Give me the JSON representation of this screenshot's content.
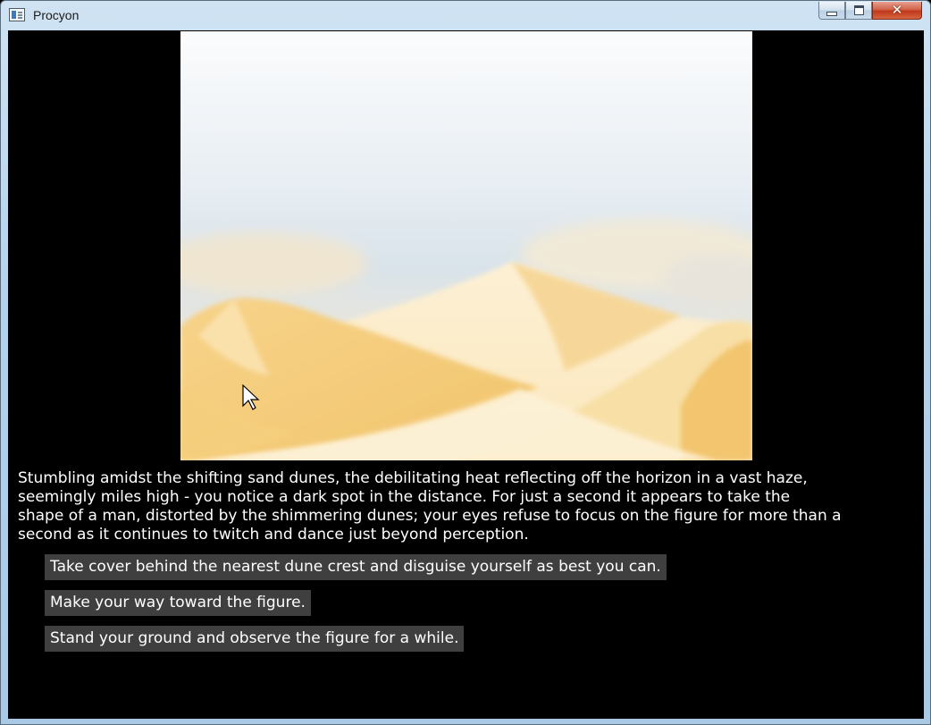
{
  "window": {
    "title": "Procyon",
    "icons": {
      "app": "window-app-icon",
      "minimize": "minimize-icon",
      "maximize": "maximize-icon",
      "close": "close-icon"
    },
    "colors": {
      "client_background": "#000000",
      "choice_background": "#3f3f3f",
      "text": "#ffffff"
    }
  },
  "scene": {
    "illustration": "desert-sand-dunes",
    "colors": {
      "sky": "#dfe8ef",
      "sand": "#f3cf82",
      "sand_light": "#fbeccd"
    }
  },
  "story": {
    "lines": [
      "Stumbling amidst the shifting sand dunes, the debilitating heat reflecting off the horizon in a vast haze,",
      "seemingly miles high - you notice a dark spot in the distance. For just a second it appears to take the",
      "shape of a man, distorted by the shimmering dunes; your eyes refuse to focus on the figure for more than a",
      "second as it continues to twitch and dance just beyond perception."
    ]
  },
  "choices": [
    {
      "label": "Take cover behind the nearest dune crest and disguise yourself as best you can."
    },
    {
      "label": "Make your way toward the figure."
    },
    {
      "label": "Stand your ground and observe the figure for a while."
    }
  ]
}
